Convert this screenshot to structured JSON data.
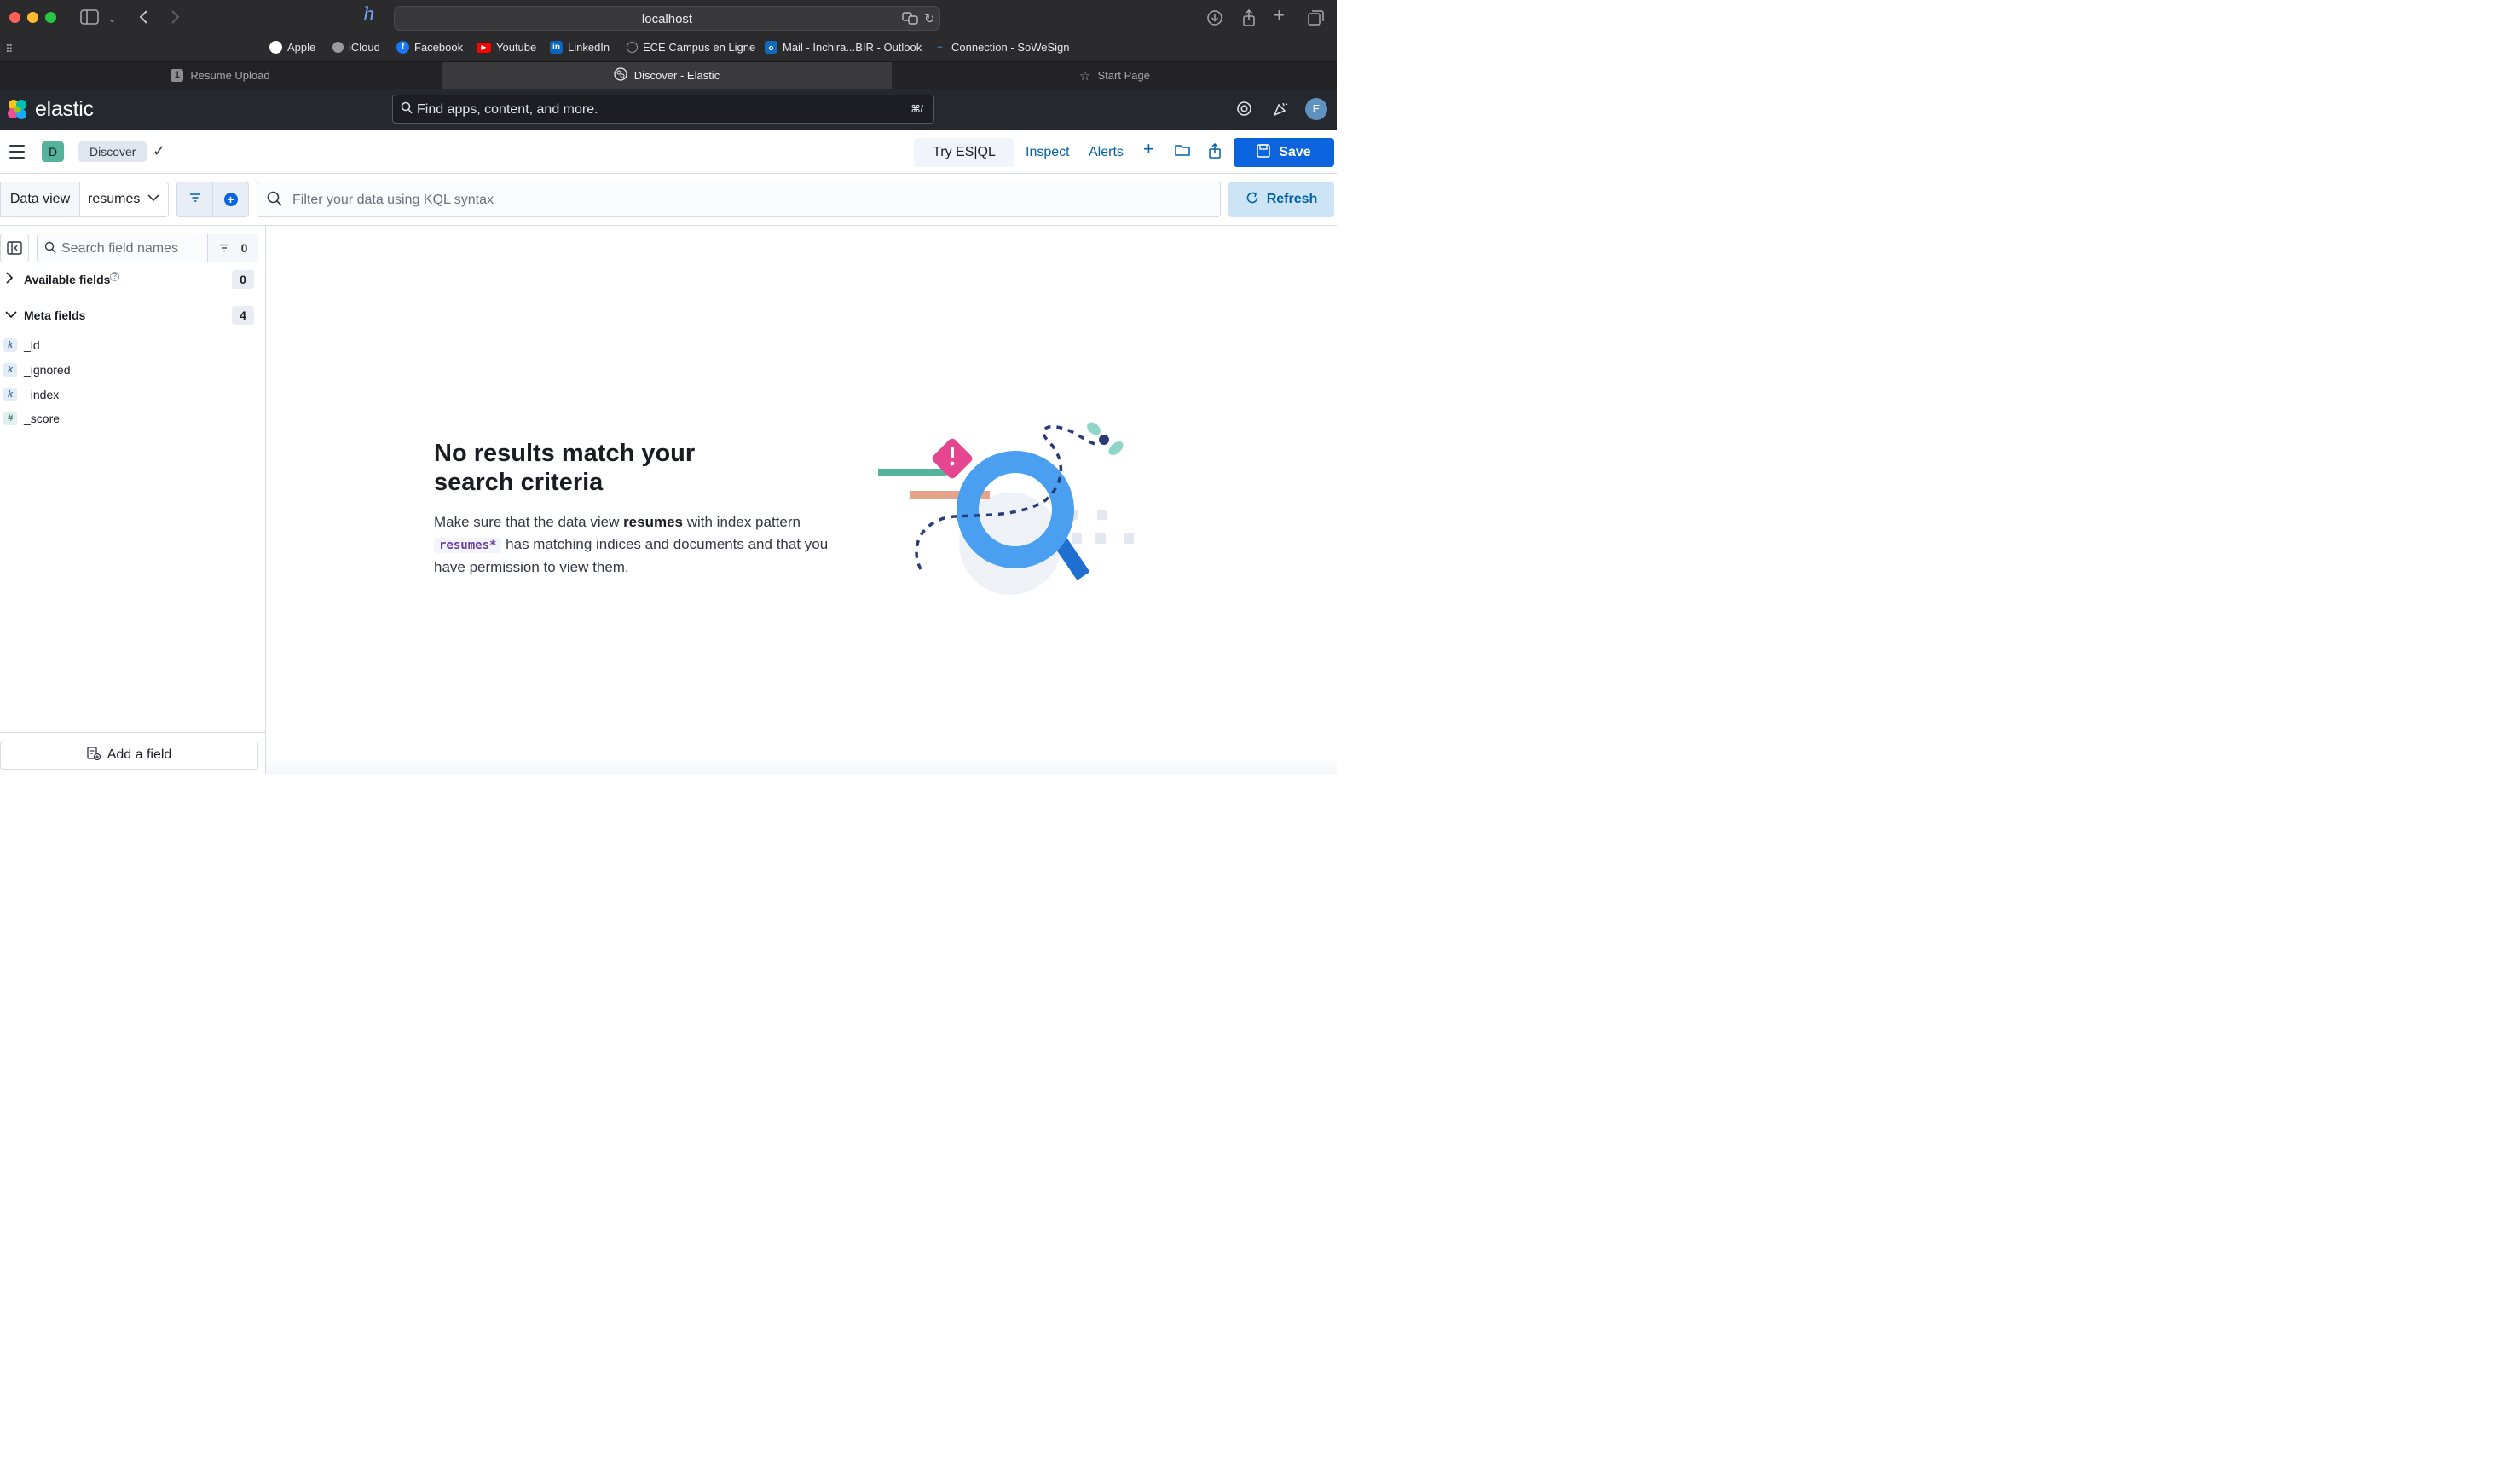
{
  "browser": {
    "url": "localhost",
    "bookmarks": [
      {
        "label": "Apple",
        "icon": "apple-icon",
        "color": "#ffffff"
      },
      {
        "label": "iCloud",
        "icon": "apple-icon",
        "color": "#b0b0b0"
      },
      {
        "label": "Facebook",
        "icon": "facebook-icon",
        "color": "#1877f2"
      },
      {
        "label": "Youtube",
        "icon": "youtube-icon",
        "color": "#ff0000"
      },
      {
        "label": "LinkedIn",
        "icon": "linkedin-icon",
        "color": "#0a66c2"
      },
      {
        "label": "ECE Campus en Ligne",
        "icon": "globe-icon",
        "color": "#9a9a9a"
      },
      {
        "label": "Mail - Inchira...BIR - Outlook",
        "icon": "outlook-icon",
        "color": "#0f6cbd"
      },
      {
        "label": "Connection - SoWeSign",
        "icon": "sowesign-icon",
        "color": "#3b7bd4"
      }
    ],
    "tabs": [
      {
        "label": "Resume Upload",
        "badge": "1",
        "active": false
      },
      {
        "label": "Discover - Elastic",
        "active": true
      },
      {
        "label": "Start Page",
        "active": false
      }
    ]
  },
  "kibana": {
    "logo": "elastic",
    "search_placeholder": "Find apps, content, and more.",
    "search_shortcut": "⌘/",
    "avatar_initial": "E"
  },
  "toolbar": {
    "space_initial": "D",
    "breadcrumb": "Discover",
    "try_esql": "Try ES|QL",
    "inspect": "Inspect",
    "alerts": "Alerts",
    "save": "Save"
  },
  "query": {
    "data_view_label": "Data view",
    "data_view_value": "resumes",
    "kql_placeholder": "Filter your data using KQL syntax",
    "refresh": "Refresh"
  },
  "sidebar": {
    "search_placeholder": "Search field names",
    "filter_count": "0",
    "available_label": "Available fields",
    "available_count": "0",
    "meta_label": "Meta fields",
    "meta_count": "4",
    "meta_fields": [
      {
        "name": "_id",
        "type": "k"
      },
      {
        "name": "_ignored",
        "type": "k"
      },
      {
        "name": "_index",
        "type": "k"
      },
      {
        "name": "_score",
        "type": "#"
      }
    ],
    "add_field": "Add a field"
  },
  "empty_state": {
    "title": "No results match your search criteria",
    "body_1": "Make sure that the data view ",
    "data_view": "resumes",
    "body_2": " with index pattern ",
    "pattern": "resumes*",
    "body_3": " has matching indices and documents and that you have permission to view them."
  },
  "colors": {
    "primary": "#0b64dd",
    "header_bg": "#25282f",
    "space_badge": "#54b399"
  }
}
